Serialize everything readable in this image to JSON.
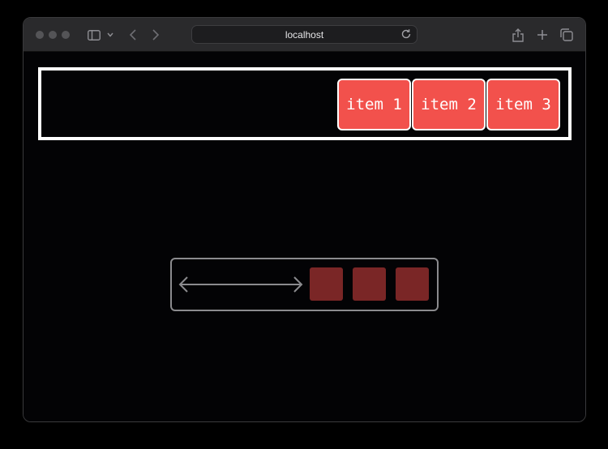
{
  "browser": {
    "address": "localhost"
  },
  "icons": {
    "sidebar": "sidebar-icon",
    "back": "chevron-left-icon",
    "forward": "chevron-right-icon",
    "reload": "reload-icon",
    "share": "share-icon",
    "new_tab": "plus-icon",
    "tabs": "tabs-overview-icon",
    "arrow": "double-arrow-icon"
  },
  "colors": {
    "item_fill": "#f2514c",
    "item_border": "#ffffff",
    "container_border": "#ffffff",
    "illustration_box": "#7a2626",
    "illustration_border": "#8b8b8e"
  },
  "flex_container": {
    "items": [
      "item 1",
      "item 2",
      "item 3"
    ]
  }
}
